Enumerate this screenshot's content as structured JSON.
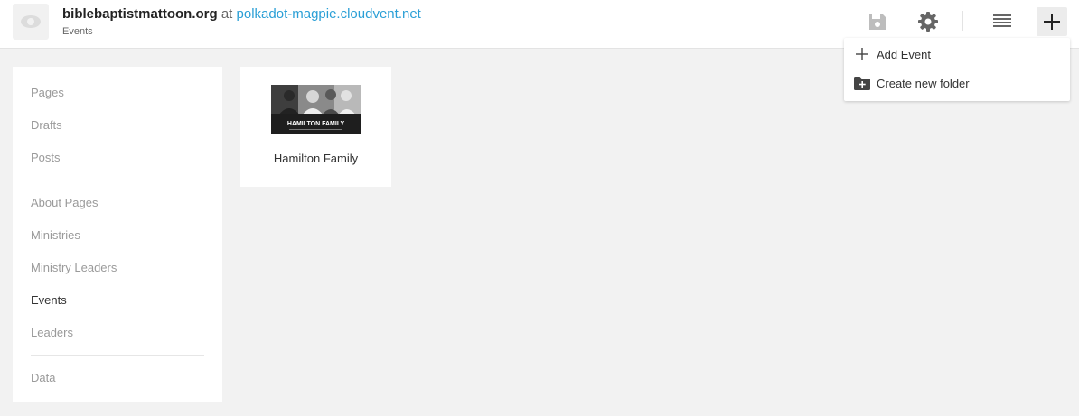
{
  "header": {
    "site_name": "biblebaptistmattoon.org",
    "at_text": "at",
    "host": "polkadot-magpie.cloudvent.net",
    "subtitle": "Events"
  },
  "toolbar": {
    "icons": [
      "save-icon",
      "gear-icon",
      "list-icon",
      "plus-icon"
    ]
  },
  "dropdown": {
    "items": [
      {
        "label": "Add Event",
        "icon": "plus-icon"
      },
      {
        "label": "Create new folder",
        "icon": "folder-plus-icon"
      }
    ]
  },
  "sidebar": {
    "items": [
      {
        "label": "Pages",
        "active": false
      },
      {
        "label": "Drafts",
        "active": false
      },
      {
        "label": "Posts",
        "active": false
      },
      {
        "label": "About Pages",
        "active": false
      },
      {
        "label": "Ministries",
        "active": false
      },
      {
        "label": "Ministry Leaders",
        "active": false
      },
      {
        "label": "Events",
        "active": true
      },
      {
        "label": "Leaders",
        "active": false
      },
      {
        "label": "Data",
        "active": false
      }
    ]
  },
  "main": {
    "cards": [
      {
        "label": "Hamilton Family",
        "thumb_text": "HAMILTON FAMILY"
      }
    ]
  },
  "colors": {
    "accent": "#2a9fd6",
    "background": "#f2f2f2"
  }
}
